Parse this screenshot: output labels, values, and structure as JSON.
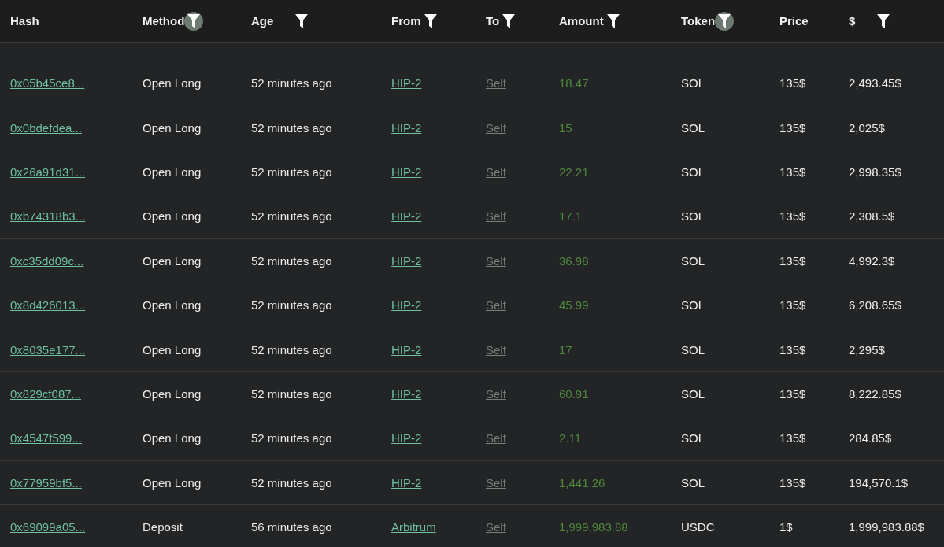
{
  "table": {
    "columns": [
      {
        "label": "Hash",
        "kind": "link"
      },
      {
        "label": "Method",
        "kind": "text",
        "filter": {
          "active": true
        }
      },
      {
        "label": "Age",
        "kind": "text",
        "filter": {
          "active": false
        }
      },
      {
        "label": "From",
        "kind": "link",
        "filter": {
          "active": false
        }
      },
      {
        "label": "To",
        "kind": "muted-link",
        "filter": {
          "active": false
        }
      },
      {
        "label": "Amount",
        "kind": "amount",
        "filter": {
          "active": false
        }
      },
      {
        "label": "Token",
        "kind": "text",
        "filter": {
          "active": true
        }
      },
      {
        "label": "Price",
        "kind": "text"
      },
      {
        "label": "$",
        "kind": "text",
        "filter": {
          "active": false
        }
      }
    ],
    "rows": [
      [
        "0x05b45ce8...",
        "Open Long",
        "52 minutes ago",
        "HIP-2",
        "Self",
        "18.47",
        "SOL",
        "135$",
        "2,493.45$"
      ],
      [
        "0x0bdefdea...",
        "Open Long",
        "52 minutes ago",
        "HIP-2",
        "Self",
        "15",
        "SOL",
        "135$",
        "2,025$"
      ],
      [
        "0x26a91d31...",
        "Open Long",
        "52 minutes ago",
        "HIP-2",
        "Self",
        "22.21",
        "SOL",
        "135$",
        "2,998.35$"
      ],
      [
        "0xb74318b3...",
        "Open Long",
        "52 minutes ago",
        "HIP-2",
        "Self",
        "17.1",
        "SOL",
        "135$",
        "2,308.5$"
      ],
      [
        "0xc35dd09c...",
        "Open Long",
        "52 minutes ago",
        "HIP-2",
        "Self",
        "36.98",
        "SOL",
        "135$",
        "4,992.3$"
      ],
      [
        "0x8d426013...",
        "Open Long",
        "52 minutes ago",
        "HIP-2",
        "Self",
        "45.99",
        "SOL",
        "135$",
        "6,208.65$"
      ],
      [
        "0x8035e177...",
        "Open Long",
        "52 minutes ago",
        "HIP-2",
        "Self",
        "17",
        "SOL",
        "135$",
        "2,295$"
      ],
      [
        "0x829cf087...",
        "Open Long",
        "52 minutes ago",
        "HIP-2",
        "Self",
        "60.91",
        "SOL",
        "135$",
        "8,222.85$"
      ],
      [
        "0x4547f599...",
        "Open Long",
        "52 minutes ago",
        "HIP-2",
        "Self",
        "2.11",
        "SOL",
        "135$",
        "284.85$"
      ],
      [
        "0x77959bf5...",
        "Open Long",
        "52 minutes ago",
        "HIP-2",
        "Self",
        "1,441.26",
        "SOL",
        "135$",
        "194,570.1$"
      ],
      [
        "0x69099a05...",
        "Deposit",
        "56 minutes ago",
        "Arbitrum",
        "Self",
        "1,999,983.88",
        "USDC",
        "1$",
        "1,999,983.88$"
      ]
    ]
  }
}
